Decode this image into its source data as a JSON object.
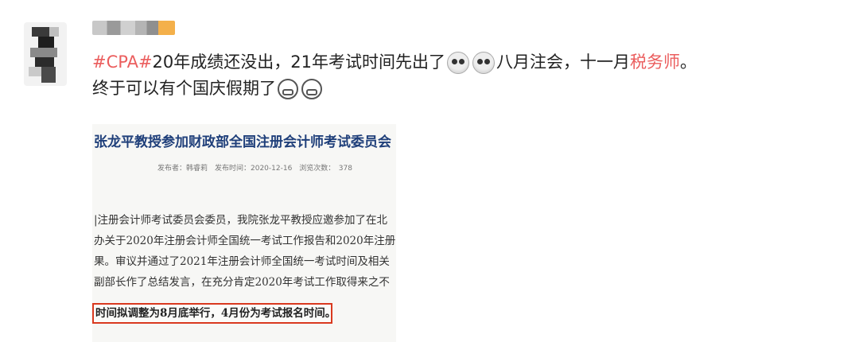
{
  "post": {
    "line1": {
      "hashtag": "#CPA#",
      "text_a": "20年成绩还没出，21年考试时间先出了",
      "emoji_a": "skull-emoji",
      "emoji_b": "skull-emoji",
      "text_b": "八月注会，十一月",
      "link": "税务师",
      "text_c": "。"
    },
    "line2": {
      "text": "终于可以有个国庆假期了",
      "emoji_a": "masked-face-emoji",
      "emoji_b": "masked-face-emoji"
    }
  },
  "image": {
    "title": "张龙平教授参加财政部全国注册会计师考试委员会",
    "meta": "发布者：韩睿莉　发布时间：2020-12-16　浏览次数：　378",
    "body": [
      "|注册会计师考试委员会委员，我院张龙平教授应邀参加了在北",
      "办关于2020年注册会计师全国统一考试工作报告和2020年注册",
      "果。审议并通过了2021年注册会计师全国统一考试时间及相关",
      "副部长作了总结发言，在充分肯定2020年考试工作取得来之不"
    ],
    "highlight": "时间拟调整为8月底举行，4月份为考试报名时间。"
  },
  "colors": {
    "link": "#eb5e5e",
    "doc_title": "#1f3f7a",
    "highlight_border": "#d9391f"
  }
}
